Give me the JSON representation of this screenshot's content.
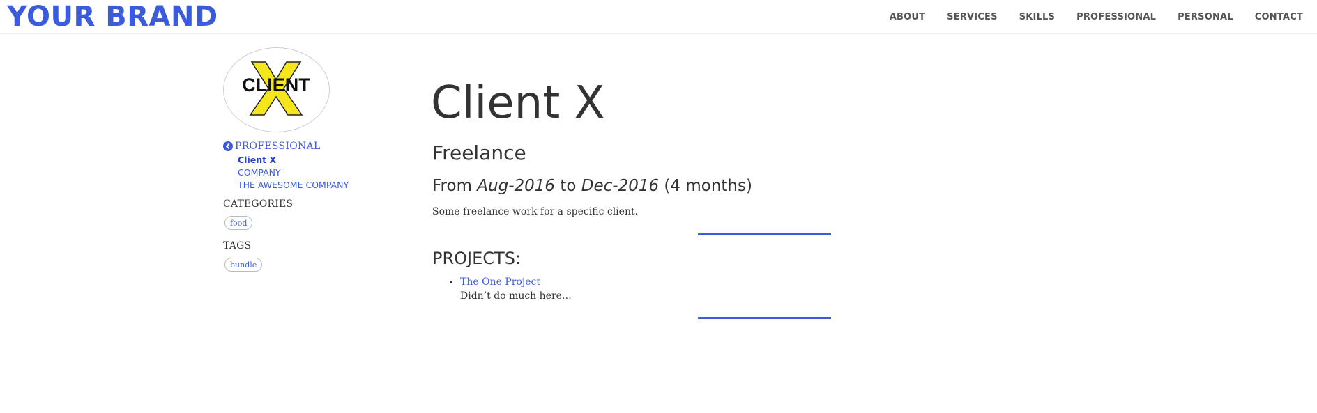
{
  "brand": "YOUR BRAND",
  "nav": [
    "ABOUT",
    "SERVICES",
    "SKILLS",
    "PROFESSIONAL",
    "PERSONAL",
    "CONTACT"
  ],
  "sidebar": {
    "logo_text": "CLIENT X",
    "back_label": "PROFESSIONAL",
    "links": [
      "Client X",
      "COMPANY",
      "THE AWESOME COMPANY"
    ],
    "categories_heading": "CATEGORIES",
    "categories": [
      "food"
    ],
    "tags_heading": "TAGS",
    "tags": [
      "bundle"
    ]
  },
  "main": {
    "title": "Client X",
    "subtitle": "Freelance",
    "from_label": "From",
    "start": "Aug-2016",
    "to_label": "to",
    "end": "Dec-2016",
    "duration": "(4 months)",
    "description": "Some freelance work for a specific client.",
    "projects_heading": "PROJECTS:",
    "projects": [
      {
        "name": "The One Project",
        "description": "Didn’t do much here…"
      }
    ]
  },
  "colors": {
    "accent": "#3a5bdc",
    "logo_yellow": "#f5e61c"
  }
}
